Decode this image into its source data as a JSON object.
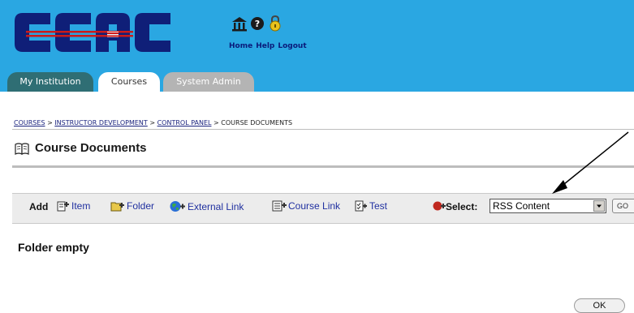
{
  "header": {
    "logo_text": "CCAC",
    "links": {
      "home": "Home",
      "help": "Help",
      "logout": "Logout"
    }
  },
  "tabs": [
    {
      "label": "My Institution",
      "active": false
    },
    {
      "label": "Courses",
      "active": true
    },
    {
      "label": "System Admin",
      "active": false
    }
  ],
  "breadcrumb": {
    "items": [
      "COURSES",
      "INSTRUCTOR DEVELOPMENT",
      "CONTROL PANEL",
      "COURSE DOCUMENTS"
    ],
    "separator": ">"
  },
  "page": {
    "title": "Course Documents",
    "empty_message": "Folder empty"
  },
  "actions": {
    "add_label": "Add",
    "item": "Item",
    "folder": "Folder",
    "external_link": "External Link",
    "course_link": "Course Link",
    "test": "Test",
    "select_label": "Select:",
    "select_value": "RSS Content",
    "go": "GO"
  },
  "footer": {
    "ok": "OK"
  },
  "icons": [
    "home-icon",
    "help-icon",
    "logout-lock-icon",
    "book-icon",
    "add-item-icon",
    "add-folder-icon",
    "globe-add-icon",
    "course-link-icon",
    "test-icon",
    "select-icon",
    "dropdown-arrow-icon"
  ],
  "colors": {
    "banner": "#2aa7e2",
    "logo_navy": "#0f1f78",
    "logo_red": "#cc1a1a",
    "tab_institution": "#2f6e74",
    "tab_admin": "#b4b4b4",
    "link": "#2030a0"
  }
}
